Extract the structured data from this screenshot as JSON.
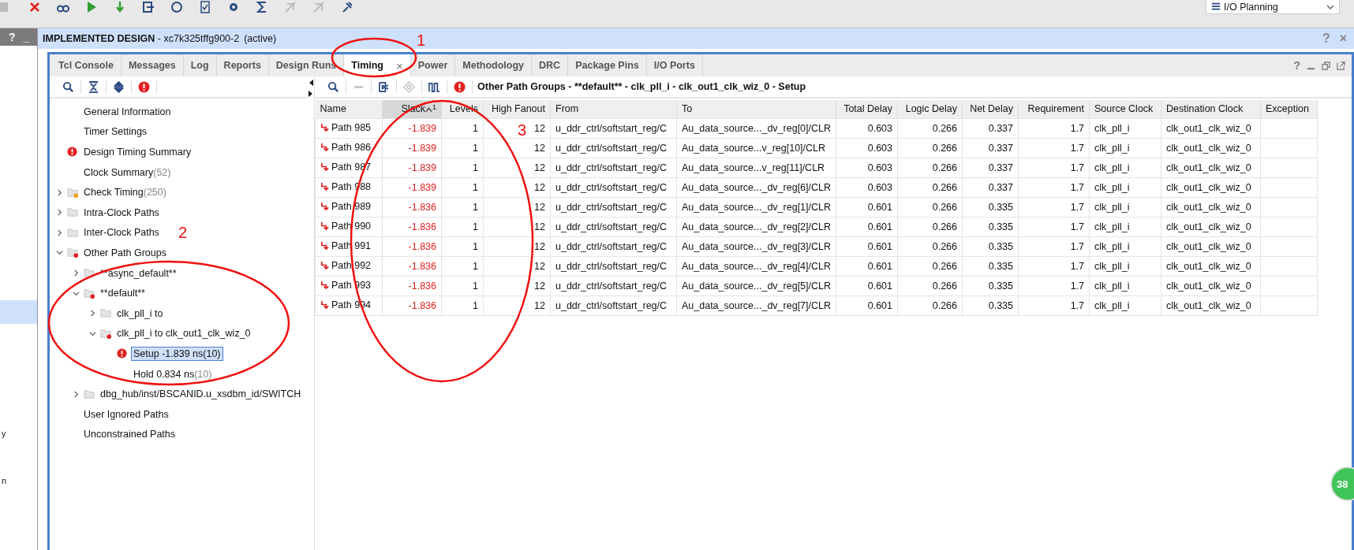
{
  "layout_dropdown": {
    "label": "I/O Planning"
  },
  "left_strip": {
    "header_buttons": [
      "?",
      "_"
    ],
    "fragments": [
      "y",
      "n"
    ]
  },
  "design_header": {
    "title": "IMPLEMENTED DESIGN",
    "part": "- xc7k325tffg900-2",
    "status": "(active)",
    "buttons": [
      "?",
      "×"
    ]
  },
  "tabs": [
    {
      "label": "Tcl Console",
      "selected": false
    },
    {
      "label": "Messages",
      "selected": false
    },
    {
      "label": "Log",
      "selected": false
    },
    {
      "label": "Reports",
      "selected": false
    },
    {
      "label": "Design Runs",
      "selected": false
    },
    {
      "label": "Timing",
      "selected": true,
      "close": "×"
    },
    {
      "label": "Power",
      "selected": false
    },
    {
      "label": "Methodology",
      "selected": false
    },
    {
      "label": "DRC",
      "selected": false
    },
    {
      "label": "Package Pins",
      "selected": false
    },
    {
      "label": "I/O Ports",
      "selected": false
    }
  ],
  "panel_buttons": [
    "?"
  ],
  "tree": [
    {
      "label": "General Information",
      "selected": false
    },
    {
      "label": "Timer Settings",
      "selected": false
    },
    {
      "label": "Design Timing Summary",
      "kind": "error",
      "selected": false
    },
    {
      "label": "Clock Summary",
      "count": "(52)",
      "selected": false
    },
    {
      "label": "Check Timing",
      "count": "(250)",
      "kind": "warning-group",
      "expanded": false,
      "selected": false
    },
    {
      "label": "Intra-Clock Paths",
      "kind": "group",
      "expanded": false,
      "selected": false
    },
    {
      "label": "Inter-Clock Paths",
      "kind": "group",
      "expanded": false,
      "selected": false
    },
    {
      "label": "Other Path Groups",
      "kind": "error-group",
      "expanded": true,
      "selected": false,
      "children": [
        {
          "label": "**async_default**",
          "kind": "group",
          "expanded": false,
          "selected": false
        },
        {
          "label": "**default**",
          "kind": "error-group",
          "expanded": true,
          "selected": false,
          "children": [
            {
              "label": "clk_pll_i to",
              "kind": "group",
              "expanded": false,
              "selected": false
            },
            {
              "label": "clk_pll_i to clk_out1_clk_wiz_0",
              "kind": "error-group",
              "expanded": true,
              "selected": false,
              "children": [
                {
                  "label": "Setup -1.839 ns",
                  "count": "(10)",
                  "kind": "error",
                  "selected": true
                },
                {
                  "label": "Hold 0.834 ns",
                  "count": "(10)",
                  "selected": false
                }
              ]
            }
          ]
        },
        {
          "label": "dbg_hub/inst/BSCANID.u_xsdbm_id/SWITCH",
          "kind": "group",
          "expanded": false,
          "selected": false
        }
      ]
    },
    {
      "label": "User Ignored Paths",
      "selected": false
    },
    {
      "label": "Unconstrained Paths",
      "selected": false
    }
  ],
  "table_title": "Other Path Groups - **default** - clk_pll_i - clk_out1_clk_wiz_0 - Setup",
  "table": {
    "columns": [
      {
        "label": "Name"
      },
      {
        "label": "Slack",
        "sorted": true,
        "sort_order": "1"
      },
      {
        "label": "Levels"
      },
      {
        "label": "High Fanout"
      },
      {
        "label": "From"
      },
      {
        "label": "To"
      },
      {
        "label": "Total Delay"
      },
      {
        "label": "Logic Delay"
      },
      {
        "label": "Net Delay"
      },
      {
        "label": "Requirement"
      },
      {
        "label": "Source Clock"
      },
      {
        "label": "Destination Clock"
      },
      {
        "label": "Exception"
      }
    ],
    "rows": [
      [
        "Path 985",
        "-1.839",
        "1",
        "12",
        "u_ddr_ctrl/softstart_reg/C",
        "Au_data_source..._dv_reg[0]/CLR",
        "0.603",
        "0.266",
        "0.337",
        "1.7",
        "clk_pll_i",
        "clk_out1_clk_wiz_0",
        ""
      ],
      [
        "Path 986",
        "-1.839",
        "1",
        "12",
        "u_ddr_ctrl/softstart_reg/C",
        "Au_data_source...v_reg[10]/CLR",
        "0.603",
        "0.266",
        "0.337",
        "1.7",
        "clk_pll_i",
        "clk_out1_clk_wiz_0",
        ""
      ],
      [
        "Path 987",
        "-1.839",
        "1",
        "12",
        "u_ddr_ctrl/softstart_reg/C",
        "Au_data_source...v_reg[11]/CLR",
        "0.603",
        "0.266",
        "0.337",
        "1.7",
        "clk_pll_i",
        "clk_out1_clk_wiz_0",
        ""
      ],
      [
        "Path 988",
        "-1.839",
        "1",
        "12",
        "u_ddr_ctrl/softstart_reg/C",
        "Au_data_source..._dv_reg[6]/CLR",
        "0.603",
        "0.266",
        "0.337",
        "1.7",
        "clk_pll_i",
        "clk_out1_clk_wiz_0",
        ""
      ],
      [
        "Path 989",
        "-1.836",
        "1",
        "12",
        "u_ddr_ctrl/softstart_reg/C",
        "Au_data_source..._dv_reg[1]/CLR",
        "0.601",
        "0.266",
        "0.335",
        "1.7",
        "clk_pll_i",
        "clk_out1_clk_wiz_0",
        ""
      ],
      [
        "Path 990",
        "-1.836",
        "1",
        "12",
        "u_ddr_ctrl/softstart_reg/C",
        "Au_data_source..._dv_reg[2]/CLR",
        "0.601",
        "0.266",
        "0.335",
        "1.7",
        "clk_pll_i",
        "clk_out1_clk_wiz_0",
        ""
      ],
      [
        "Path 991",
        "-1.836",
        "1",
        "12",
        "u_ddr_ctrl/softstart_reg/C",
        "Au_data_source..._dv_reg[3]/CLR",
        "0.601",
        "0.266",
        "0.335",
        "1.7",
        "clk_pll_i",
        "clk_out1_clk_wiz_0",
        ""
      ],
      [
        "Path 992",
        "-1.836",
        "1",
        "12",
        "u_ddr_ctrl/softstart_reg/C",
        "Au_data_source..._dv_reg[4]/CLR",
        "0.601",
        "0.266",
        "0.335",
        "1.7",
        "clk_pll_i",
        "clk_out1_clk_wiz_0",
        ""
      ],
      [
        "Path 993",
        "-1.836",
        "1",
        "12",
        "u_ddr_ctrl/softstart_reg/C",
        "Au_data_source..._dv_reg[5]/CLR",
        "0.601",
        "0.266",
        "0.335",
        "1.7",
        "clk_pll_i",
        "clk_out1_clk_wiz_0",
        ""
      ],
      [
        "Path 994",
        "-1.836",
        "1",
        "12",
        "u_ddr_ctrl/softstart_reg/C",
        "Au_data_source..._dv_reg[7]/CLR",
        "0.601",
        "0.266",
        "0.335",
        "1.7",
        "clk_pll_i",
        "clk_out1_clk_wiz_0",
        ""
      ]
    ]
  },
  "badge": "38",
  "annotations": [
    {
      "label": "1"
    },
    {
      "label": "2"
    },
    {
      "label": "3"
    }
  ]
}
